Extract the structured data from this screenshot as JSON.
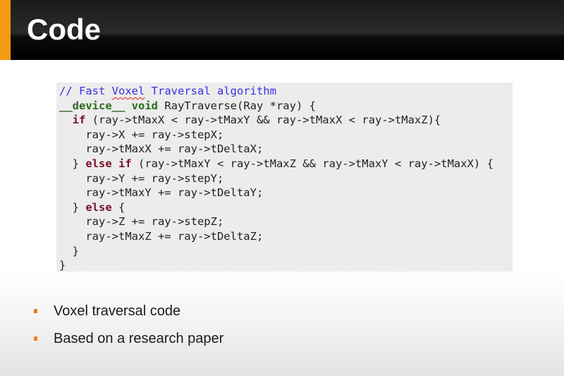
{
  "slide": {
    "title": "Code",
    "accent_color": "#f39c12",
    "bullet_color": "#e8801c"
  },
  "code": {
    "language": "CUDA C",
    "lines": [
      {
        "segments": [
          {
            "text": "// Fast ",
            "style": "comment"
          },
          {
            "text": "Voxel",
            "style": "comment-misspelled"
          },
          {
            "text": " Traversal algorithm",
            "style": "comment"
          }
        ]
      },
      {
        "segments": [
          {
            "text": "__device__",
            "style": "type"
          },
          {
            "text": " ",
            "style": "plain"
          },
          {
            "text": "void",
            "style": "type"
          },
          {
            "text": " RayTraverse(Ray *ray) {",
            "style": "plain"
          }
        ]
      },
      {
        "segments": [
          {
            "text": "  ",
            "style": "plain"
          },
          {
            "text": "if",
            "style": "keyword"
          },
          {
            "text": " (ray->tMaxX < ray->tMaxY && ray->tMaxX < ray->tMaxZ){",
            "style": "plain"
          }
        ]
      },
      {
        "segments": [
          {
            "text": "    ray->X += ray->stepX;",
            "style": "plain"
          }
        ]
      },
      {
        "segments": [
          {
            "text": "    ray->tMaxX += ray->tDeltaX;",
            "style": "plain"
          }
        ]
      },
      {
        "segments": [
          {
            "text": "  } ",
            "style": "plain"
          },
          {
            "text": "else if",
            "style": "keyword"
          },
          {
            "text": " (ray->tMaxY < ray->tMaxZ && ray->tMaxY < ray->tMaxX) {",
            "style": "plain"
          }
        ]
      },
      {
        "segments": [
          {
            "text": "    ray->Y += ray->stepY;",
            "style": "plain"
          }
        ]
      },
      {
        "segments": [
          {
            "text": "    ray->tMaxY += ray->tDeltaY;",
            "style": "plain"
          }
        ]
      },
      {
        "segments": [
          {
            "text": "  } ",
            "style": "plain"
          },
          {
            "text": "else",
            "style": "keyword"
          },
          {
            "text": " {",
            "style": "plain"
          }
        ]
      },
      {
        "segments": [
          {
            "text": "    ray->Z += ray->stepZ;",
            "style": "plain"
          }
        ]
      },
      {
        "segments": [
          {
            "text": "    ray->tMaxZ += ray->tDeltaZ;",
            "style": "plain"
          }
        ]
      },
      {
        "segments": [
          {
            "text": "  }",
            "style": "plain"
          }
        ]
      },
      {
        "segments": [
          {
            "text": "}",
            "style": "plain"
          }
        ]
      }
    ]
  },
  "bullets": [
    {
      "text": "Voxel traversal code"
    },
    {
      "text": "Based on a research paper"
    }
  ]
}
